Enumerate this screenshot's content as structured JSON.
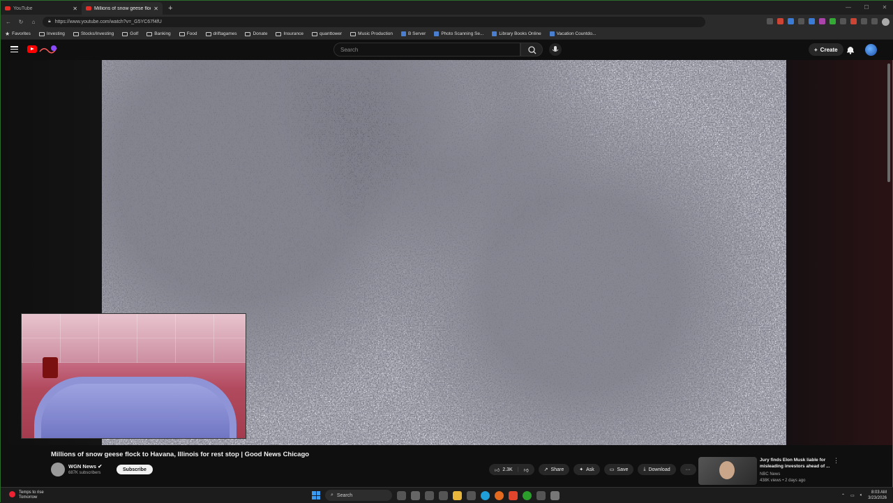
{
  "browser": {
    "tabs": [
      {
        "label": "YouTube",
        "active": false
      },
      {
        "label": "Millions of snow geese flock to Ha",
        "active": true
      }
    ],
    "url": "https://www.youtube.com/watch?v=_G5YC67f4fU",
    "favorites": [
      {
        "label": "Favorites",
        "icon": "star-icon"
      },
      {
        "label": "Investing",
        "icon": "folder-icon"
      },
      {
        "label": "Stocks/Investing",
        "icon": "folder-icon"
      },
      {
        "label": "Golf",
        "icon": "folder-icon"
      },
      {
        "label": "Banking",
        "icon": "folder-icon"
      },
      {
        "label": "Food",
        "icon": "folder-icon"
      },
      {
        "label": "driftagames",
        "icon": "folder-icon"
      },
      {
        "label": "Donate",
        "icon": "folder-icon"
      },
      {
        "label": "Insurance",
        "icon": "folder-icon"
      },
      {
        "label": "quanttower",
        "icon": "folder-icon"
      },
      {
        "label": "Music Production",
        "icon": "folder-icon"
      },
      {
        "label": "B Server",
        "icon": "site-icon"
      },
      {
        "label": "Photo Scanning Se...",
        "icon": "site-icon"
      },
      {
        "label": "Library Books Online",
        "icon": "site-icon"
      },
      {
        "label": "Vacation Countdo...",
        "icon": "site-icon"
      }
    ]
  },
  "youtube": {
    "search_placeholder": "Search",
    "create_label": "Create",
    "video": {
      "title": "Millions of snow geese flock to Havana, Illinois for rest stop | Good News Chicago",
      "channel": "WGN News",
      "subscribers": "687K subscribers",
      "subscribe_label": "Subscribe",
      "likes": "2.3K",
      "share_label": "Share",
      "ask_label": "Ask",
      "save_label": "Save",
      "download_label": "Download"
    },
    "recommended": {
      "title": "Jury finds Elon Musk liable for misleading investors ahead of ...",
      "channel": "NBC News",
      "meta": "438K views • 2 days ago"
    }
  },
  "taskbar": {
    "weather_line1": "Temps to rise",
    "weather_line2": "Tomorrow",
    "search_label": "Search",
    "time": "8:03 AM",
    "date": "3/23/2026"
  },
  "colors": {
    "youtube_red": "#ff0000",
    "background": "#0f0f0f",
    "windows_accent": "#3a9cf0"
  }
}
